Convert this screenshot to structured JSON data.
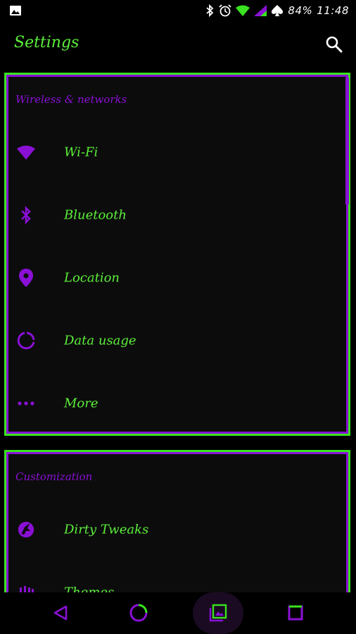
{
  "status_bar": {
    "battery_text": "84%",
    "time": "11:48",
    "icons": [
      "image-notification-icon",
      "bluetooth-icon",
      "alarm-icon",
      "wifi-signal-icon",
      "cell-signal-icon",
      "spade-icon"
    ]
  },
  "app_bar": {
    "title": "Settings",
    "search_icon": "search-icon"
  },
  "sections": [
    {
      "title": "Wireless & networks",
      "items": [
        {
          "label": "Wi-Fi",
          "icon": "wifi-icon"
        },
        {
          "label": "Bluetooth",
          "icon": "bluetooth-icon"
        },
        {
          "label": "Location",
          "icon": "location-pin-icon"
        },
        {
          "label": "Data usage",
          "icon": "data-usage-icon"
        },
        {
          "label": "More",
          "icon": "more-dots-icon"
        }
      ]
    },
    {
      "title": "Customization",
      "items": [
        {
          "label": "Dirty Tweaks",
          "icon": "unicorn-icon"
        },
        {
          "label": "Themes",
          "icon": "themes-icon"
        }
      ]
    }
  ],
  "nav_bar": [
    "back-icon",
    "home-icon",
    "screenshot-icon",
    "recents-icon"
  ],
  "colors": {
    "accent_green": "#5cf03a",
    "accent_purple": "#8a10d6",
    "background": "#000000",
    "card": "#0c0c0c"
  }
}
